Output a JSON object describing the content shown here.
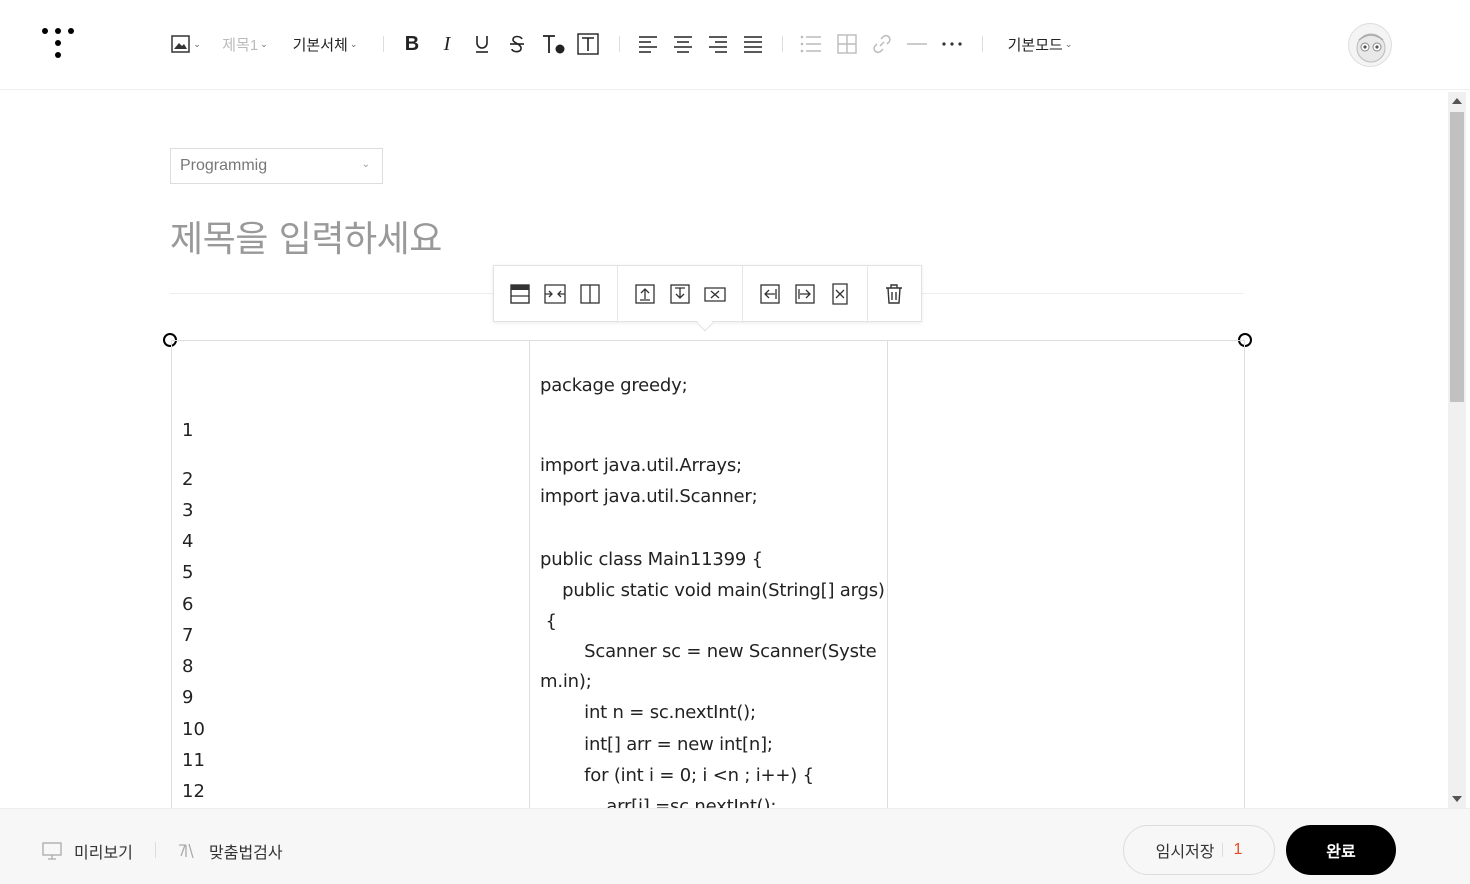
{
  "toolbar": {
    "heading_label": "제목1",
    "font_label": "기본서체",
    "mode_label": "기본모드"
  },
  "editor": {
    "category": "Programmig",
    "title_placeholder": "제목을 입력하세요"
  },
  "table": {
    "line_numbers": [
      "1",
      "2",
      "3",
      "4",
      "5",
      "6",
      "7",
      "8",
      "9",
      "10",
      "11",
      "12"
    ],
    "code_lines": [
      "package greedy;",
      "import java.util.Arrays;",
      "import java.util.Scanner;",
      "public class Main11399 {",
      "    public static void main(String[] args)",
      " {",
      "        Scanner sc = new Scanner(Syste",
      "m.in);",
      "        int n = sc.nextInt();",
      "        int[] arr = new int[n];",
      "        for (int i = 0; i <n ; i++) {",
      "            arr[i] =sc.nextInt();"
    ]
  },
  "bottom": {
    "preview_label": "미리보기",
    "spellcheck_label": "맞춤법검사",
    "draft_label": "임시저장",
    "draft_count": "1",
    "done_label": "완료"
  }
}
